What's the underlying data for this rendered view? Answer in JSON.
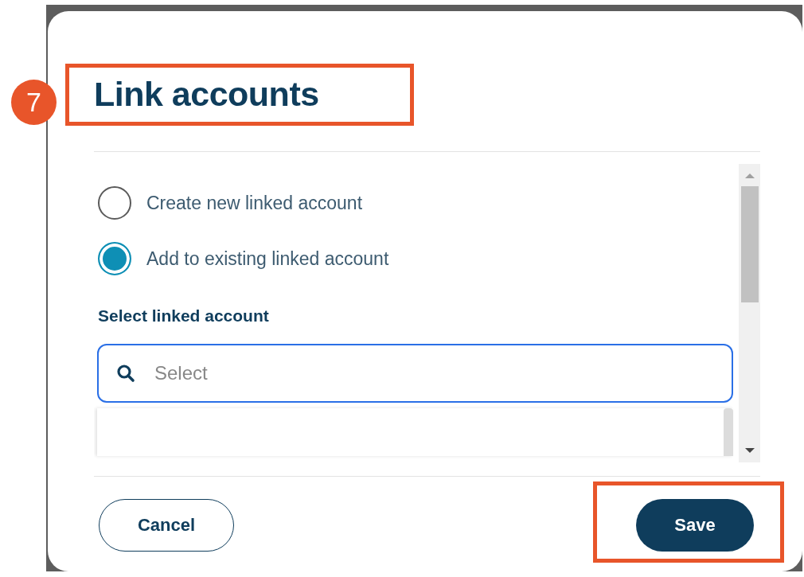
{
  "step_badge": "7",
  "dialog": {
    "title": "Link accounts",
    "title_highlighted": true,
    "options": [
      {
        "label": "Create new linked account",
        "selected": false
      },
      {
        "label": "Add to existing linked account",
        "selected": true
      }
    ],
    "field_label": "Select linked account",
    "search": {
      "placeholder": "Select"
    },
    "buttons": [
      {
        "kind": "secondary",
        "label": "Cancel",
        "highlighted": false
      },
      {
        "kind": "primary",
        "label": "Save",
        "highlighted": true
      }
    ]
  }
}
